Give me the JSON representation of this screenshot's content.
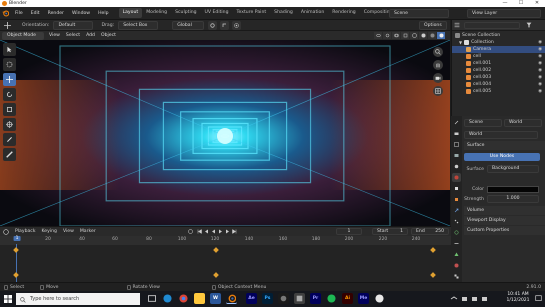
{
  "window": {
    "title": "Blender",
    "minimize": "—",
    "maximize": "☐",
    "close": "✕"
  },
  "menubar": {
    "items": [
      "File",
      "Edit",
      "Render",
      "Window",
      "Help"
    ],
    "workspaces": [
      "Layout",
      "Modeling",
      "Sculpting",
      "UV Editing",
      "Texture Paint",
      "Shading",
      "Animation",
      "Rendering",
      "Compositing"
    ],
    "active_workspace": "Layout",
    "scene": "Scene",
    "view_layer": "View Layer"
  },
  "tool_settings": {
    "orientation_label": "Orientation:",
    "orientation_value": "Default",
    "drag_label": "Drag:",
    "drag_value": "Select Box",
    "transform_value": "Global",
    "options_label": "Options"
  },
  "viewport_header": {
    "mode": "Object Mode",
    "menus": [
      "View",
      "Select",
      "Add",
      "Object"
    ]
  },
  "outliner": {
    "root": "Scene Collection",
    "items": [
      {
        "label": "Collection",
        "level": 1
      },
      {
        "label": "Camera",
        "level": 2
      },
      {
        "label": "cell",
        "level": 2
      },
      {
        "label": "cell.001",
        "level": 2
      },
      {
        "label": "cell.002",
        "level": 2
      },
      {
        "label": "cell.003",
        "level": 2
      },
      {
        "label": "cell.004",
        "level": 2
      },
      {
        "label": "cell.005",
        "level": 2
      }
    ]
  },
  "properties": {
    "scene_label": "Scene",
    "world_label": "World",
    "world_name": "World",
    "surface_header": "Surface",
    "use_nodes": "Use Nodes",
    "surface_label": "Surface",
    "surface_value": "Background",
    "color_label": "Color",
    "strength_label": "Strength",
    "strength_value": "1.000",
    "volume_header": "Volume",
    "viewport_display_header": "Viewport Display",
    "custom_props_header": "Custom Properties"
  },
  "timeline": {
    "menus": [
      "Playback",
      "Keying",
      "View",
      "Marker"
    ],
    "current_frame": "1",
    "start_label": "Start",
    "start_value": "1",
    "end_label": "End",
    "end_value": "250",
    "ticks": [
      "1",
      "20",
      "40",
      "60",
      "80",
      "100",
      "120",
      "140",
      "160",
      "180",
      "200",
      "220",
      "240"
    ]
  },
  "statusbar": {
    "select": "Select",
    "move": "Move",
    "rotate": "Rotate View",
    "context": "Object Context Menu",
    "version": "2.91.0"
  },
  "taskbar": {
    "search_placeholder": "Type here to search",
    "time": "10:41 AM",
    "date": "1/12/2021"
  },
  "colors": {
    "accent": "#4772b3",
    "selected": "#334d80",
    "active_tab": "#3b3b3b"
  }
}
